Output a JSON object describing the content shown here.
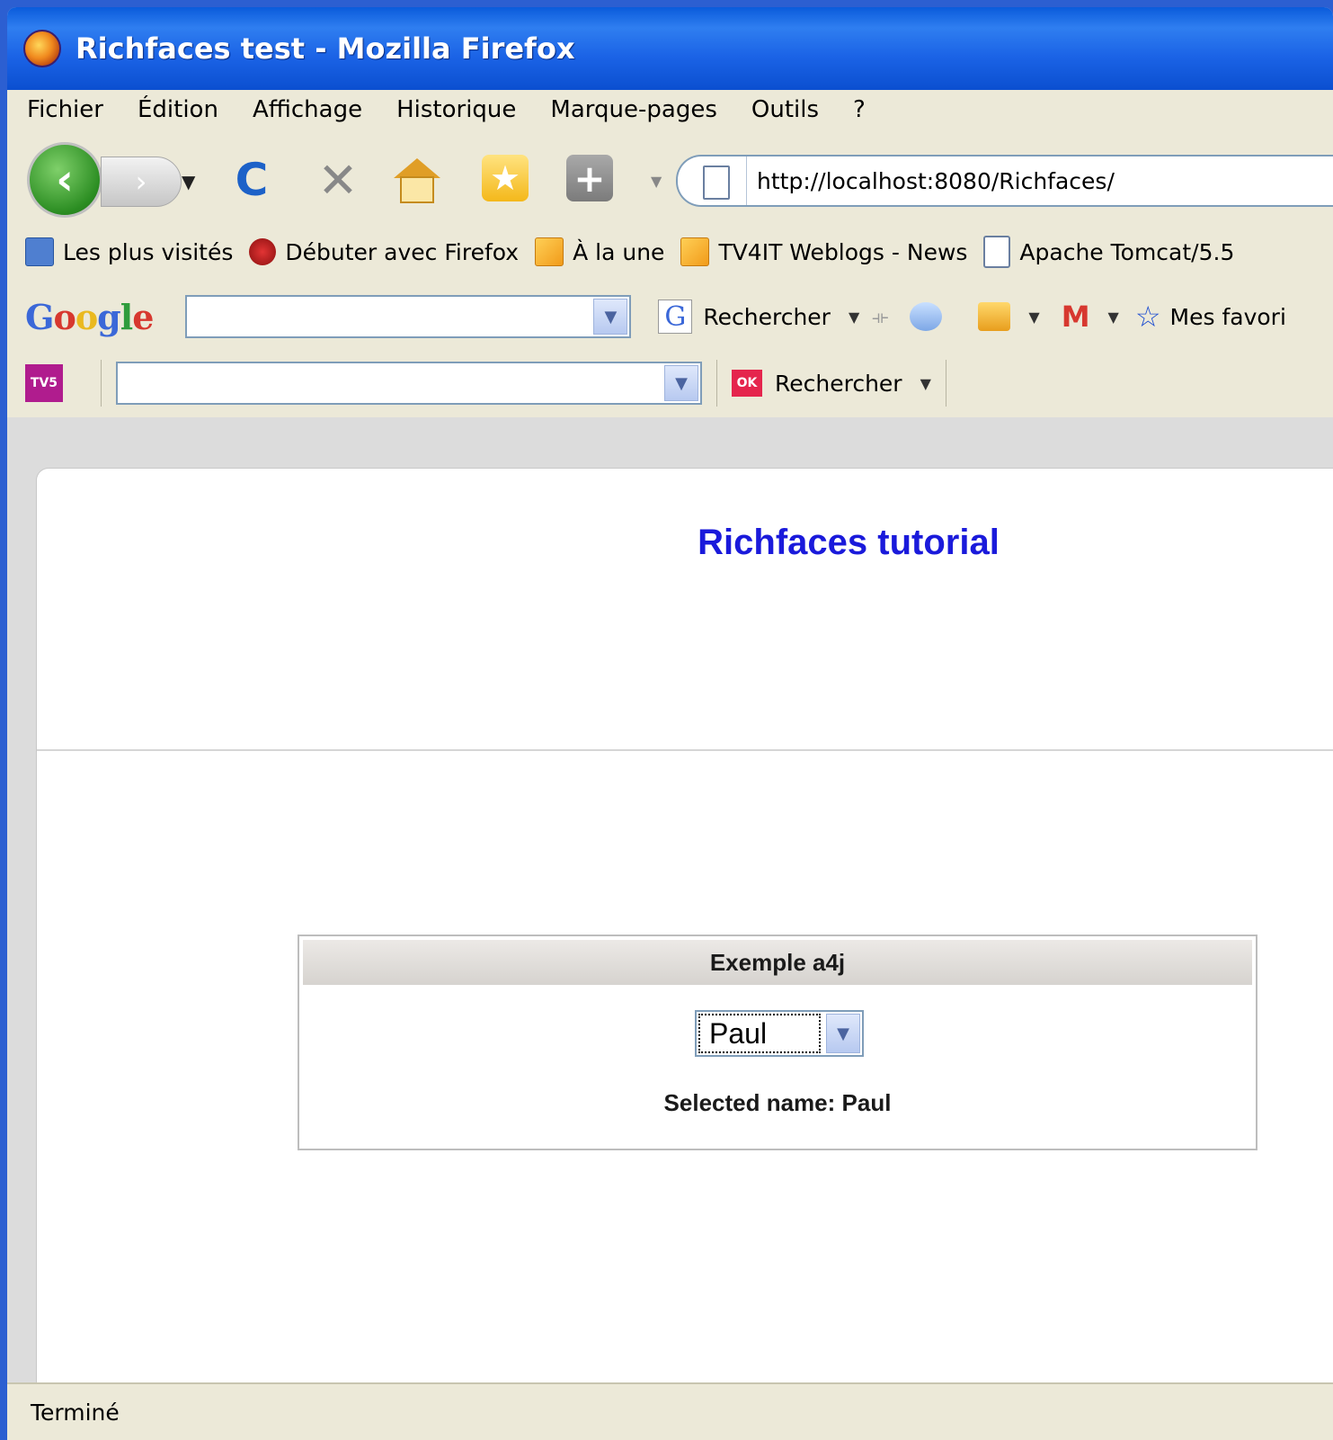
{
  "window": {
    "title": "Richfaces test - Mozilla Firefox"
  },
  "menu": [
    "Fichier",
    "Édition",
    "Affichage",
    "Historique",
    "Marque-pages",
    "Outils",
    "?"
  ],
  "navbar": {
    "url": "http://localhost:8080/Richfaces/"
  },
  "bookmarks": [
    {
      "label": "Les plus visités",
      "icon": "search-page-icon"
    },
    {
      "label": "Débuter avec Firefox",
      "icon": "firefox-red-icon"
    },
    {
      "label": "À la une",
      "icon": "rss-icon"
    },
    {
      "label": "TV4IT Weblogs - News",
      "icon": "rss-icon"
    },
    {
      "label": "Apache Tomcat/5.5",
      "icon": "page-icon"
    }
  ],
  "google_toolbar": {
    "logo": "Google",
    "search_value": "",
    "search_label": "Rechercher",
    "favorites_label": "Mes favori"
  },
  "tv5_toolbar": {
    "logo": "TV5",
    "search_value": "",
    "ok_label": "OK",
    "search_label": "Rechercher"
  },
  "page": {
    "title": "Richfaces tutorial",
    "panel_header": "Exemple a4j",
    "select_value": "Paul",
    "selected_text": "Selected name: Paul"
  },
  "status": {
    "text": "Terminé"
  }
}
